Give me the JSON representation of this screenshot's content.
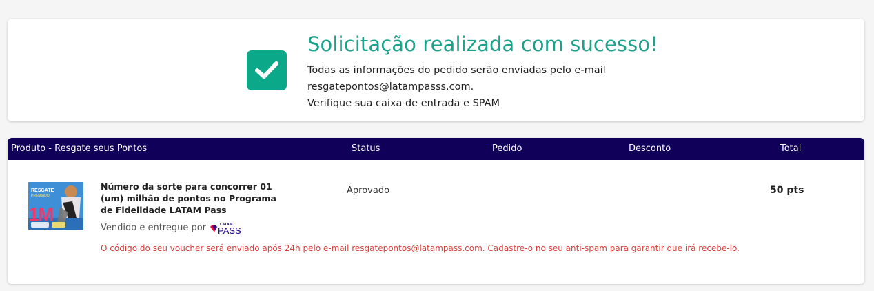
{
  "success": {
    "title": "Solicitação realizada com sucesso!",
    "line1": "Todas as informações do pedido serão enviadas pelo e-mail",
    "line2": "resgatepontos@latampasss.com.",
    "line3": "Verifique sua caixa de entrada e SPAM",
    "icon": "check-icon",
    "icon_color": "#0ca88a",
    "title_color": "#1aa38a"
  },
  "table": {
    "header_color": "#10005a",
    "headers": {
      "product": "Produto - Resgate seus Pontos",
      "status": "Status",
      "pedido": "Pedido",
      "desconto": "Desconto",
      "total": "Total"
    },
    "rows": [
      {
        "product_name": "Número da sorte para concorrer 01 (um) milhão de pontos no Programa de Fidelidade LATAM Pass",
        "sold_by": "Vendido e entregue por",
        "seller_logo": "LATAM PASS",
        "status": "Aprovado",
        "pedido": "",
        "desconto": "",
        "total": "50 pts",
        "note": "O código do seu voucher será enviado após 24h pelo e-mail resgatepontos@latampass.com. Cadastre-o no seu anti-spam para garantir que irá recebe-lo."
      }
    ]
  }
}
